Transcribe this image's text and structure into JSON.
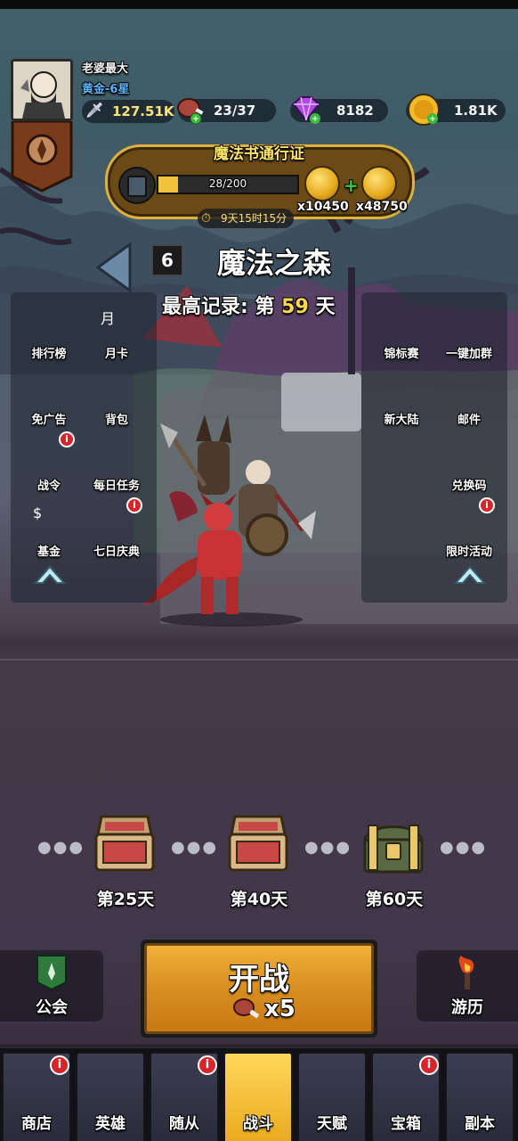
{
  "player": {
    "name": "老婆最大",
    "rank": "黄金-6星",
    "power": "127.51K"
  },
  "resources": {
    "meat": "23/37",
    "gems": "8182",
    "coins": "1.81K"
  },
  "pass": {
    "title": "魔法书通行证",
    "progress_text": "28/200",
    "progress_fraction": 0.14,
    "reward1": "x10450",
    "reward2": "x48750",
    "timer": "9天15时15分"
  },
  "stage": {
    "number": "6",
    "name": "魔法之森",
    "record_prefix": "最高记录: 第",
    "record_day": "59",
    "record_suffix": "天"
  },
  "left_menu": [
    {
      "label": "排行榜",
      "icon": "trophy-icon",
      "badge": false
    },
    {
      "label": "月卡",
      "icon": "month-card-icon",
      "badge": false
    },
    {
      "label": "免广告",
      "icon": "no-ads-icon",
      "badge": false
    },
    {
      "label": "背包",
      "icon": "backpack-icon",
      "badge": false
    },
    {
      "label": "战令",
      "icon": "battle-pass-icon",
      "badge": true
    },
    {
      "label": "每日任务",
      "icon": "daily-task-icon",
      "badge": false
    },
    {
      "label": "基金",
      "icon": "fund-icon",
      "badge": false
    },
    {
      "label": "七日庆典",
      "icon": "seven-day-icon",
      "badge": true
    }
  ],
  "right_menu": [
    {
      "label": "锦标赛",
      "icon": "tournament-icon",
      "badge": false
    },
    {
      "label": "一键加群",
      "icon": "qq-icon",
      "badge": false
    },
    {
      "label": "新大陆",
      "icon": "new-continent-icon",
      "badge": false
    },
    {
      "label": "邮件",
      "icon": "mail-icon",
      "badge": false
    },
    {
      "label": "兑换码",
      "icon": "ticket-icon",
      "badge": false
    },
    {
      "label": "限时活动",
      "icon": "wheel-icon",
      "badge": true
    }
  ],
  "badge_glyph": "i",
  "chests": [
    {
      "label": "第25天"
    },
    {
      "label": "第40天"
    },
    {
      "label": "第60天"
    }
  ],
  "actions": {
    "guild": "公会",
    "fight": "开战",
    "fight_cost": "x5",
    "travel": "游历"
  },
  "nav": [
    {
      "label": "商店",
      "icon": "shop-icon",
      "badge": true
    },
    {
      "label": "英雄",
      "icon": "hero-icon",
      "badge": false
    },
    {
      "label": "随从",
      "icon": "follower-icon",
      "badge": true
    },
    {
      "label": "战斗",
      "icon": "battle-icon",
      "badge": false,
      "active": true
    },
    {
      "label": "天赋",
      "icon": "talent-icon",
      "badge": false
    },
    {
      "label": "宝箱",
      "icon": "treasure-icon",
      "badge": true
    },
    {
      "label": "副本",
      "icon": "dungeon-icon",
      "badge": false
    }
  ],
  "colors": {
    "gold": "#ffd84a",
    "rank_blue": "#5fb4ff",
    "badge_red": "#d7262b",
    "active_tab": "#ffd75a"
  }
}
